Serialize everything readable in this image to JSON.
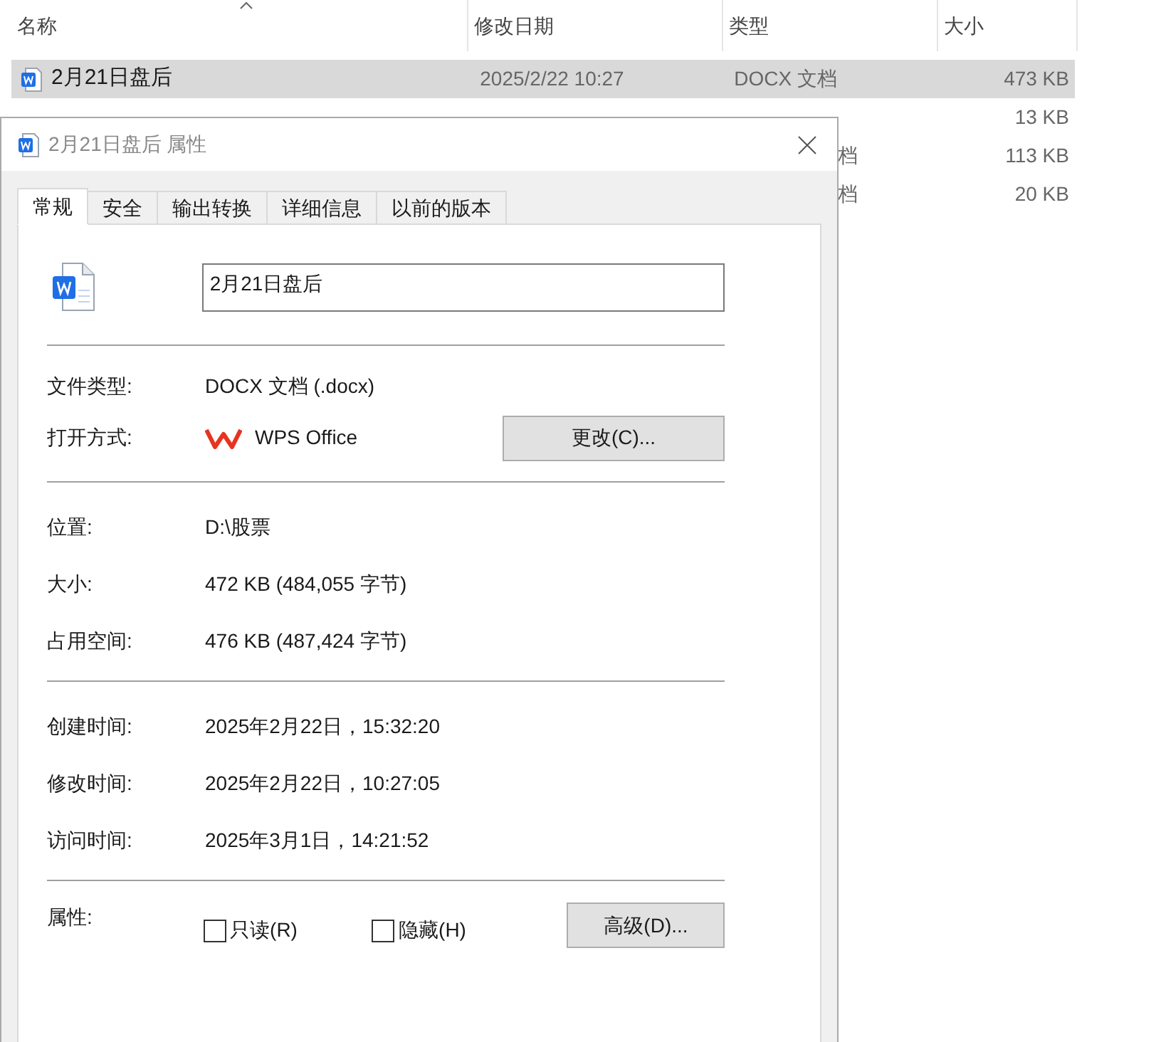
{
  "explorer": {
    "columns": [
      {
        "label": "名称",
        "sorted": true
      },
      {
        "label": "修改日期",
        "sorted": false
      },
      {
        "label": "类型",
        "sorted": false
      },
      {
        "label": "大小",
        "sorted": false
      }
    ],
    "rows": [
      {
        "kind": "word",
        "name": "2月21日盘后",
        "date": "2025/2/22 10:27",
        "type": "DOCX 文档",
        "size": "473 KB",
        "selected": true
      },
      {
        "kind": "hidden",
        "size": "13 KB",
        "selected": false
      },
      {
        "kind": "hidden",
        "type": "档",
        "size": "113 KB",
        "selected": false
      },
      {
        "kind": "hidden",
        "type": "档",
        "size": "20 KB",
        "selected": false
      }
    ]
  },
  "dialog": {
    "title": "2月21日盘后 属性",
    "tabs": [
      {
        "label": "常规",
        "selected": true
      },
      {
        "label": "安全",
        "selected": false
      },
      {
        "label": "输出转换",
        "selected": false
      },
      {
        "label": "详细信息",
        "selected": false
      },
      {
        "label": "以前的版本",
        "selected": false
      }
    ],
    "file_name": "2月21日盘后",
    "file_type": {
      "label": "文件类型:",
      "value": "DOCX 文档 (.docx)"
    },
    "open_with": {
      "label": "打开方式:",
      "app": "WPS Office",
      "button": "更改(C)..."
    },
    "location": {
      "label": "位置:",
      "value": "D:\\股票"
    },
    "size": {
      "label": "大小:",
      "value": "472 KB (484,055 字节)"
    },
    "disk_size": {
      "label": "占用空间:",
      "value": "476 KB (487,424 字节)"
    },
    "created": {
      "label": "创建时间:",
      "value": "2025年2月22日，15:32:20"
    },
    "modified": {
      "label": "修改时间:",
      "value": "2025年2月22日，10:27:05"
    },
    "accessed": {
      "label": "访问时间:",
      "value": "2025年3月1日，14:21:52"
    },
    "attributes": {
      "label": "属性:",
      "checkboxes": [
        {
          "label": "只读(R)",
          "checked": false
        },
        {
          "label": "隐藏(H)",
          "checked": false
        }
      ],
      "button": "高级(D)..."
    }
  }
}
